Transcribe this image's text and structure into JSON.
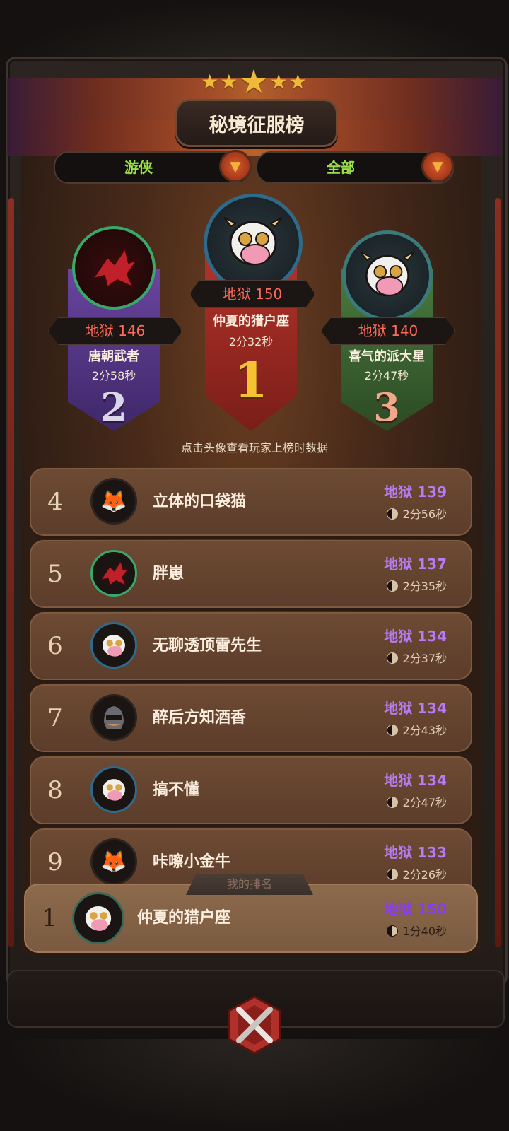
{
  "header": {
    "title": "秘境征服榜",
    "stars_count": 5
  },
  "filters": {
    "class_filter": "游侠",
    "scope_filter": "全部"
  },
  "podium": [
    {
      "rank": "2",
      "score": "地狱 146",
      "name": "唐朝武者",
      "time": "2分58秒",
      "avatar_icon": "red-dragon-icon",
      "color": "#5b3a8a"
    },
    {
      "rank": "1",
      "score": "地狱 150",
      "name": "仲夏的猎户座",
      "time": "2分32秒",
      "avatar_icon": "cow-goggles-icon",
      "color": "#a8302a"
    },
    {
      "rank": "3",
      "score": "地狱 140",
      "name": "喜气的派大星",
      "time": "2分47秒",
      "avatar_icon": "cow-goggles-icon",
      "color": "#3f6a34"
    }
  ],
  "hint": "点击头像查看玩家上榜时数据",
  "leaderboard": [
    {
      "rank": "4",
      "name": "立体的口袋猫",
      "score": "地狱 139",
      "time": "2分56秒",
      "avatar_icon": "fox-icon"
    },
    {
      "rank": "5",
      "name": "胖崽",
      "score": "地狱 137",
      "time": "2分35秒",
      "avatar_icon": "red-dragon-icon"
    },
    {
      "rank": "6",
      "name": "无聊透顶雷先生",
      "score": "地狱 134",
      "time": "2分37秒",
      "avatar_icon": "cow-goggles-icon"
    },
    {
      "rank": "7",
      "name": "醉后方知酒香",
      "score": "地狱 134",
      "time": "2分43秒",
      "avatar_icon": "knight-helmet-icon"
    },
    {
      "rank": "8",
      "name": "搞不懂",
      "score": "地狱 134",
      "time": "2分47秒",
      "avatar_icon": "cow-goggles-icon"
    },
    {
      "rank": "9",
      "name": "咔嚓小金牛",
      "score": "地狱 133",
      "time": "2分26秒",
      "avatar_icon": "fox-icon"
    }
  ],
  "my_rank": {
    "tab_label": "我的排名",
    "rank": "1",
    "name": "仲夏的猎户座",
    "score": "地狱 150",
    "time": "1分40秒",
    "avatar_icon": "cow-goggles-icon"
  },
  "close_button_icon": "close-crossed-swords-icon",
  "colors": {
    "score_purple": "#b77cf4",
    "score_red": "#ff6a5a",
    "filter_green": "#9be04a",
    "gold": "#f0b93a"
  }
}
